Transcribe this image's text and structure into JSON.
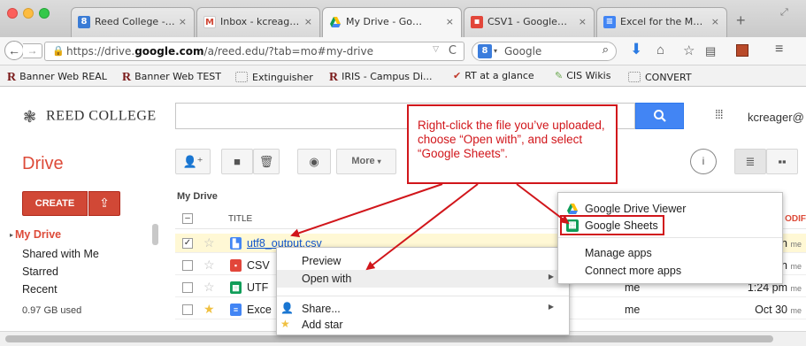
{
  "browser": {
    "tabs": [
      {
        "label": "Reed College -…",
        "icon": "reed-college-favicon",
        "close": "×"
      },
      {
        "label": "Inbox - kcreag…",
        "icon": "gmail-icon",
        "close": "×"
      },
      {
        "label": "My Drive - Go…",
        "icon": "google-drive-icon",
        "close": "×"
      },
      {
        "label": "CSV1 - Google…",
        "icon": "google-slides-icon",
        "close": "×"
      },
      {
        "label": "Excel for the M…",
        "icon": "google-docs-icon",
        "close": "×"
      }
    ],
    "new_tab": "+",
    "url_prefix": "https://drive.",
    "url_domain": "google.com",
    "url_rest": "/a/reed.edu/?tab=mo#my-drive",
    "search_placeholder": "Google",
    "bookmarks": [
      {
        "label": "Banner Web REAL",
        "icon": "R"
      },
      {
        "label": "Banner Web TEST",
        "icon": "R"
      },
      {
        "label": "Extinguisher",
        "icon": "folder"
      },
      {
        "label": "IRIS - Campus Di...",
        "icon": "R"
      },
      {
        "label": "RT at a glance",
        "icon": "check"
      },
      {
        "label": "CIS Wikis",
        "icon": "brush"
      },
      {
        "label": "CONVERT",
        "icon": "folder"
      }
    ]
  },
  "header": {
    "logo_text": "REED COLLEGE",
    "search_icon": "search-icon",
    "username": "kcreager@"
  },
  "drive": {
    "title": "Drive",
    "create_label": "CREATE",
    "upload_icon": "upload-icon",
    "more_label": "More",
    "nav": [
      "My Drive",
      "Shared with Me",
      "Starred",
      "Recent"
    ],
    "storage": "0.97 GB used",
    "breadcrumb": "My Drive",
    "column_title": "TITLE",
    "column_modified": "ODIF",
    "files": [
      {
        "name": "utf8_output.csv",
        "owner": "",
        "modified": "n",
        "modified_by": "me",
        "checked": true,
        "starred": false,
        "icon": "file-icon",
        "color": "#4285f4"
      },
      {
        "name": "CSV",
        "owner": "",
        "modified": "n",
        "modified_by": "me",
        "checked": false,
        "starred": false,
        "icon": "slides-icon",
        "color": "#e2463a"
      },
      {
        "name": "UTF",
        "owner": "me",
        "modified": "1:24 pm",
        "modified_by": "me",
        "checked": false,
        "starred": false,
        "icon": "sheets-icon",
        "color": "#0f9d58"
      },
      {
        "name": "Exce",
        "owner": "me",
        "modified": "Oct 30",
        "modified_by": "me",
        "checked": false,
        "starred": true,
        "icon": "docs-icon",
        "color": "#4285f4"
      }
    ]
  },
  "context_menu": {
    "items": [
      "Preview",
      "Open with",
      "Share...",
      "Add star"
    ]
  },
  "open_with_menu": {
    "items": [
      "Google Drive Viewer",
      "Google Sheets",
      "Manage apps",
      "Connect more apps"
    ]
  },
  "annotation": {
    "text": "Right-click the file you’ve uploaded, choose “Open with”, and select “Google Sheets”."
  },
  "colors": {
    "drive_red": "#dd4b39",
    "annotation_red": "#d1161b",
    "blue": "#4285f4"
  }
}
